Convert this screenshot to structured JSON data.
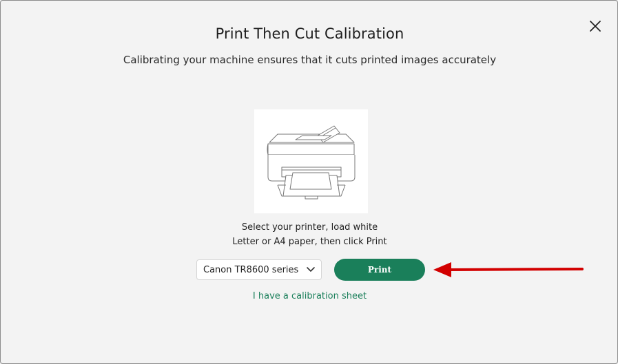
{
  "dialog": {
    "title": "Print Then Cut Calibration",
    "subtitle": "Calibrating your machine ensures that it cuts printed images accurately",
    "instructions_line1": "Select your printer, load white",
    "instructions_line2": "Letter or A4 paper, then click Print",
    "printer_select": {
      "selected": "Canon TR8600 series"
    },
    "print_label": "Print",
    "calibration_sheet_link": "I have a calibration sheet"
  },
  "icons": {
    "close": "close-icon",
    "printer": "printer-illustration",
    "chevron": "chevron-down-icon",
    "annotation": "red-arrow-annotation"
  },
  "colors": {
    "accent_green": "#1a7f5a",
    "background": "#f3f3f3",
    "annotation_red": "#d20000"
  }
}
